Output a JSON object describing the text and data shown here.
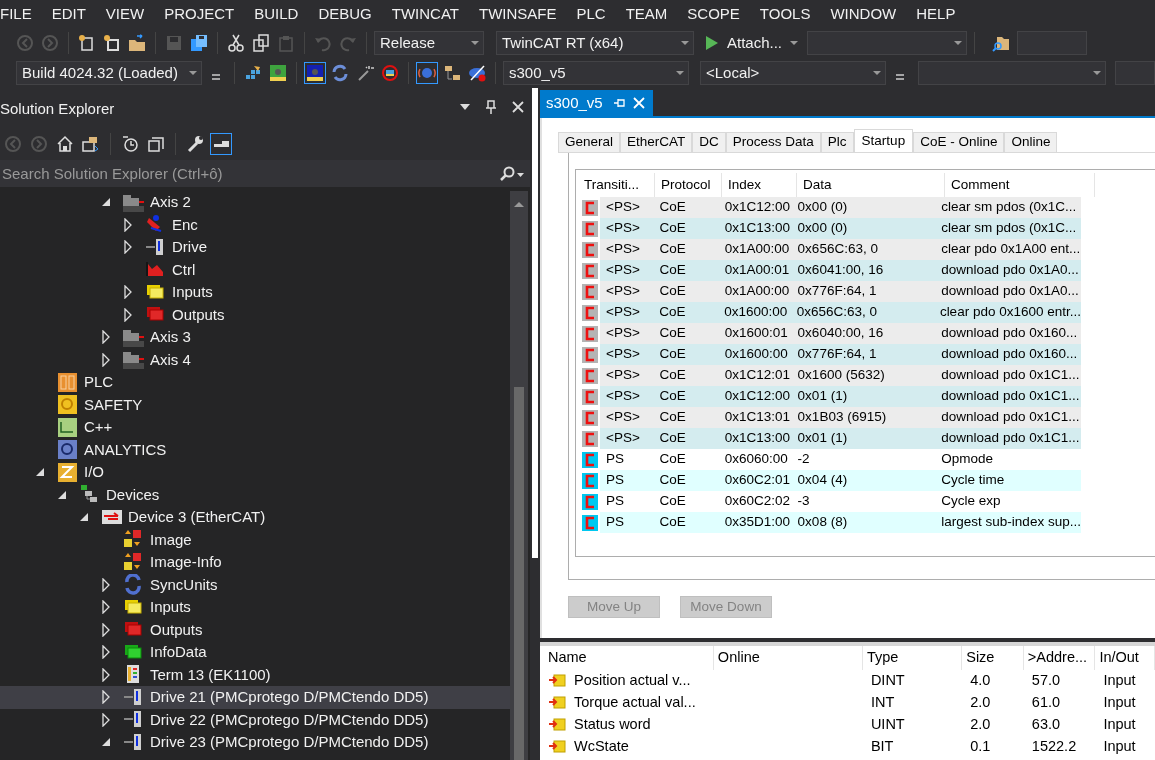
{
  "menu": [
    "FILE",
    "EDIT",
    "VIEW",
    "PROJECT",
    "BUILD",
    "DEBUG",
    "TWINCAT",
    "TWINSAFE",
    "PLC",
    "TEAM",
    "SCOPE",
    "TOOLS",
    "WINDOW",
    "HELP"
  ],
  "toolbar_1": {
    "icons_left": [
      {
        "kind": "back",
        "checked": false
      },
      {
        "kind": "forward",
        "checked": false
      },
      {
        "kind": "new-project",
        "checked": false
      },
      {
        "kind": "add-item",
        "checked": false
      },
      {
        "kind": "open",
        "checked": false
      },
      {
        "kind": "save",
        "checked": false
      },
      {
        "kind": "save-all",
        "checked": false
      },
      {
        "kind": "cut",
        "checked": false
      },
      {
        "kind": "copy",
        "checked": false
      },
      {
        "kind": "paste",
        "checked": false
      },
      {
        "kind": "undo",
        "checked": false
      },
      {
        "kind": "redo",
        "checked": false
      }
    ],
    "configuration": "Release",
    "platform": "TwinCAT RT (x64)",
    "attach": "Attach..."
  },
  "toolbar_2": {
    "build": "Build 4024.32 (Loaded)",
    "icons": [
      {
        "kind": "overflow",
        "checked": false
      },
      {
        "kind": "activate",
        "checked": false
      },
      {
        "kind": "config-mode",
        "checked": false
      },
      {
        "kind": "run-mode",
        "checked": true
      },
      {
        "kind": "reload",
        "checked": false
      },
      {
        "kind": "scan",
        "checked": false
      },
      {
        "kind": "restart",
        "checked": false
      },
      {
        "kind": "free-run",
        "checked": true
      },
      {
        "kind": "tree",
        "checked": false
      },
      {
        "kind": "hide",
        "checked": false
      }
    ],
    "target": "s300_v5",
    "route": "<Local>"
  },
  "solution_explorer": {
    "title": "Solution Explorer",
    "icons": [
      {
        "kind": "back",
        "checked": false
      },
      {
        "kind": "forward",
        "checked": false
      },
      {
        "kind": "home",
        "checked": false
      },
      {
        "kind": "switch-view",
        "checked": false
      },
      {
        "kind": "history",
        "checked": false
      },
      {
        "kind": "collapse",
        "checked": false
      },
      {
        "kind": "properties",
        "checked": false
      },
      {
        "kind": "preview",
        "checked": true
      }
    ],
    "search_placeholder": "Search Solution Explorer (Ctrl+ô)",
    "partial_branch": [
      {
        "label": "Axis 2",
        "kind": "axis",
        "expanded": true,
        "selected": false,
        "children": [
          {
            "label": "Enc",
            "kind": "encoder",
            "expanded": false,
            "selected": false
          },
          {
            "label": "Drive",
            "kind": "drive",
            "expanded": false,
            "selected": false
          },
          {
            "label": "Ctrl",
            "kind": "controller",
            "selected": false
          },
          {
            "label": "Inputs",
            "kind": "inputs",
            "expanded": false,
            "selected": false
          },
          {
            "label": "Outputs",
            "kind": "outputs",
            "expanded": false,
            "selected": false
          }
        ]
      },
      {
        "label": "Axis 3",
        "kind": "axis",
        "expanded": false,
        "selected": false
      },
      {
        "label": "Axis 4",
        "kind": "axis",
        "expanded": false,
        "selected": false
      }
    ],
    "tree": [
      {
        "label": "PLC",
        "kind": "plc",
        "selected": false
      },
      {
        "label": "SAFETY",
        "kind": "safety",
        "selected": false
      },
      {
        "label": "C++",
        "kind": "cpp",
        "selected": false
      },
      {
        "label": "ANALYTICS",
        "kind": "analytics",
        "selected": false
      },
      {
        "label": "I/O",
        "kind": "io",
        "expanded": true,
        "selected": false,
        "children": [
          {
            "label": "Devices",
            "kind": "devices",
            "expanded": true,
            "selected": false,
            "children": [
              {
                "label": "Device 3 (EtherCAT)",
                "kind": "ethercat",
                "expanded": true,
                "selected": false,
                "children": [
                  {
                    "label": "Image",
                    "kind": "image",
                    "selected": false
                  },
                  {
                    "label": "Image-Info",
                    "kind": "image",
                    "selected": false
                  },
                  {
                    "label": "SyncUnits",
                    "kind": "sync",
                    "expanded": false,
                    "selected": false
                  },
                  {
                    "label": "Inputs",
                    "kind": "inputs",
                    "expanded": false,
                    "selected": false
                  },
                  {
                    "label": "Outputs",
                    "kind": "outputs",
                    "expanded": false,
                    "selected": false
                  },
                  {
                    "label": "InfoData",
                    "kind": "infodata",
                    "expanded": false,
                    "selected": false
                  },
                  {
                    "label": "Term 13 (EK1100)",
                    "kind": "terminal",
                    "expanded": false,
                    "selected": false
                  },
                  {
                    "label": "Drive 21 (PMCprotego D/PMCtendo DD5)",
                    "kind": "drive",
                    "expanded": false,
                    "selected": true
                  },
                  {
                    "label": "Drive 22 (PMCprotego D/PMCtendo DD5)",
                    "kind": "drive",
                    "expanded": false,
                    "selected": false
                  },
                  {
                    "label": "Drive 23 (PMCprotego D/PMCtendo DD5)",
                    "kind": "drive",
                    "expanded": true,
                    "selected": false
                  }
                ]
              }
            ]
          }
        ]
      }
    ]
  },
  "document": {
    "tab": "s300_v5",
    "tabs": [
      {
        "label": "General",
        "selected": false
      },
      {
        "label": "EtherCAT",
        "selected": false
      },
      {
        "label": "DC",
        "selected": false
      },
      {
        "label": "Process Data",
        "selected": false
      },
      {
        "label": "Plc",
        "selected": false
      },
      {
        "label": "Startup",
        "selected": true
      },
      {
        "label": "CoE - Online",
        "selected": false
      },
      {
        "label": "Online",
        "selected": false
      }
    ],
    "startup": {
      "columns": [
        "Transiti...",
        "Protocol",
        "Index",
        "Data",
        "Comment"
      ],
      "rows": [
        {
          "kind": "fixed",
          "cells": [
            "<PS>",
            "CoE",
            "0x1C12:00",
            "0x00 (0)",
            "clear sm pdos (0x1C..."
          ]
        },
        {
          "kind": "fixed",
          "cells": [
            "<PS>",
            "CoE",
            "0x1C13:00",
            "0x00 (0)",
            "clear sm pdos (0x1C..."
          ]
        },
        {
          "kind": "fixed",
          "cells": [
            "<PS>",
            "CoE",
            "0x1A00:00",
            "0x656C:63, 0",
            "clear pdo 0x1A00 ent..."
          ]
        },
        {
          "kind": "fixed",
          "cells": [
            "<PS>",
            "CoE",
            "0x1A00:01",
            "0x6041:00, 16",
            "download pdo 0x1A0..."
          ]
        },
        {
          "kind": "fixed",
          "cells": [
            "<PS>",
            "CoE",
            "0x1A00:00",
            "0x776F:64, 1",
            "download pdo 0x1A0..."
          ]
        },
        {
          "kind": "fixed",
          "cells": [
            "<PS>",
            "CoE",
            "0x1600:00",
            "0x656C:63, 0",
            "clear pdo 0x1600 entr..."
          ]
        },
        {
          "kind": "fixed",
          "cells": [
            "<PS>",
            "CoE",
            "0x1600:01",
            "0x6040:00, 16",
            "download pdo 0x160..."
          ]
        },
        {
          "kind": "fixed",
          "cells": [
            "<PS>",
            "CoE",
            "0x1600:00",
            "0x776F:64, 1",
            "download pdo 0x160..."
          ]
        },
        {
          "kind": "fixed",
          "cells": [
            "<PS>",
            "CoE",
            "0x1C12:01",
            "0x1600 (5632)",
            "download pdo 0x1C1..."
          ]
        },
        {
          "kind": "fixed",
          "cells": [
            "<PS>",
            "CoE",
            "0x1C12:00",
            "0x01 (1)",
            "download pdo 0x1C1..."
          ]
        },
        {
          "kind": "fixed",
          "cells": [
            "<PS>",
            "CoE",
            "0x1C13:01",
            "0x1B03 (6915)",
            "download pdo 0x1C1..."
          ]
        },
        {
          "kind": "fixed",
          "cells": [
            "<PS>",
            "CoE",
            "0x1C13:00",
            "0x01 (1)",
            "download pdo 0x1C1..."
          ]
        },
        {
          "kind": "user",
          "cells": [
            "PS",
            "CoE",
            "0x6060:00",
            "-2",
            "Opmode"
          ]
        },
        {
          "kind": "user",
          "cells": [
            "PS",
            "CoE",
            "0x60C2:01",
            "0x04 (4)",
            "Cycle time"
          ]
        },
        {
          "kind": "user",
          "cells": [
            "PS",
            "CoE",
            "0x60C2:02",
            "-3",
            "Cycle exp"
          ]
        },
        {
          "kind": "user",
          "cells": [
            "PS",
            "CoE",
            "0x35D1:00",
            "0x08 (8)",
            "largest sub-index sup..."
          ]
        }
      ]
    },
    "buttons": [
      {
        "label": "Move Up",
        "disabled": true
      },
      {
        "label": "Move Down",
        "disabled": true
      }
    ]
  },
  "variables": {
    "columns": [
      "Name",
      "Online",
      "Type",
      "Size",
      ">Addre...",
      "In/Out"
    ],
    "rows": [
      [
        "Position actual v...",
        "",
        "DINT",
        "4.0",
        "57.0",
        "Input"
      ],
      [
        "Torque actual val...",
        "",
        "INT",
        "2.0",
        "61.0",
        "Input"
      ],
      [
        "Status word",
        "",
        "UINT",
        "2.0",
        "63.0",
        "Input"
      ],
      [
        "WcState",
        "",
        "BIT",
        "0.1",
        "1522.2",
        "Input"
      ]
    ]
  }
}
